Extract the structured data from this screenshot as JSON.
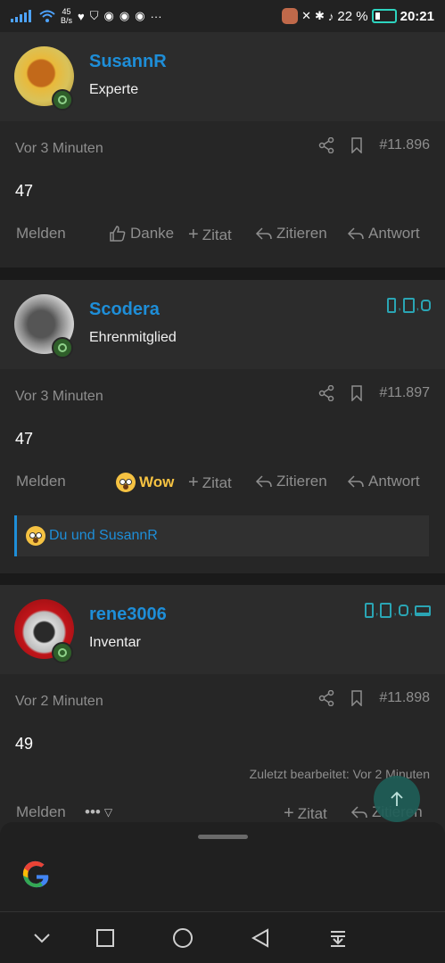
{
  "status_bar": {
    "net_speed_value": "45",
    "net_speed_unit": "B/s",
    "battery_percent": "22 %",
    "time": "20:21"
  },
  "posts": [
    {
      "username": "SusannR",
      "user_title": "Experte",
      "time_ago": "Vor 3 Minuten",
      "post_number": "#11.896",
      "content": "47",
      "actions": {
        "report": "Melden",
        "thanks": "Danke",
        "quote_plus": "Zitat",
        "quote": "Zitieren",
        "reply": "Antwort"
      }
    },
    {
      "username": "Scodera",
      "user_title": "Ehrenmitglied",
      "time_ago": "Vor 3 Minuten",
      "post_number": "#11.897",
      "content": "47",
      "device_sep": ",",
      "actions": {
        "report": "Melden",
        "reaction": "Wow",
        "quote_plus": "Zitat",
        "quote": "Zitieren",
        "reply": "Antwort"
      },
      "reactions_text": "Du und SusannR"
    },
    {
      "username": "rene3006",
      "user_title": "Inventar",
      "time_ago": "Vor 2 Minuten",
      "post_number": "#11.898",
      "content": "49",
      "edited_note": "Zuletzt bearbeitet: Vor 2 Minuten",
      "device_sep": ",",
      "actions": {
        "report": "Melden",
        "more": "•••",
        "quote_plus": "Zitat",
        "quote": "Zitieren"
      }
    }
  ],
  "colors": {
    "username": "#1e8ed8",
    "accent_teal": "#2aa5b4",
    "wow": "#f5c242"
  },
  "icons": {
    "share": "share-icon",
    "bookmark": "bookmark-icon",
    "thumbs_up": "thumbs-up-icon",
    "plus": "plus-icon",
    "quote_reply": "reply-icon",
    "scroll_top": "arrow-up-icon",
    "google": "google-icon"
  },
  "nav_bar": [
    "chevron-down-icon",
    "recents-icon",
    "home-icon",
    "back-icon",
    "notification-drawer-icon"
  ]
}
